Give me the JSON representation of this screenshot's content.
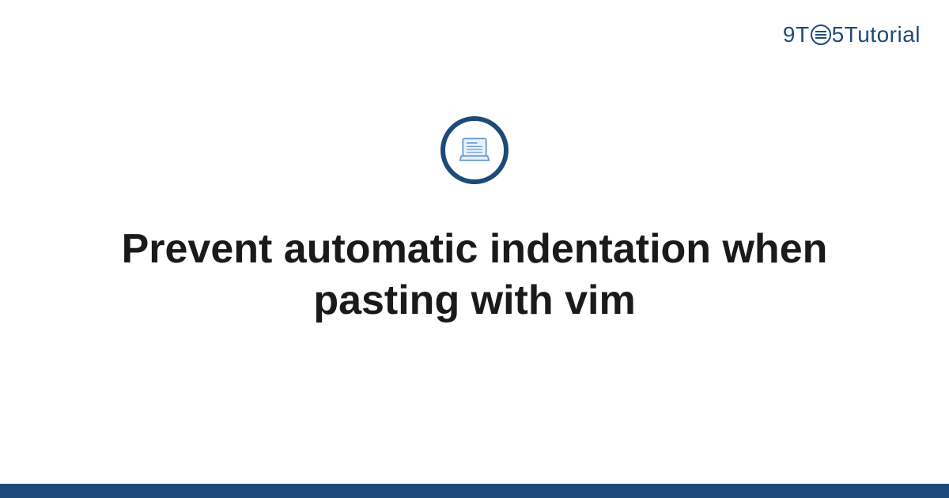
{
  "logo": {
    "part1": "9",
    "part2": "T",
    "part3": "5",
    "part4": "Tutorial"
  },
  "title": "Prevent automatic indentation when pasting with vim",
  "colors": {
    "brand": "#1e4a7a",
    "text": "#1a1a1a",
    "background": "#ffffff"
  }
}
